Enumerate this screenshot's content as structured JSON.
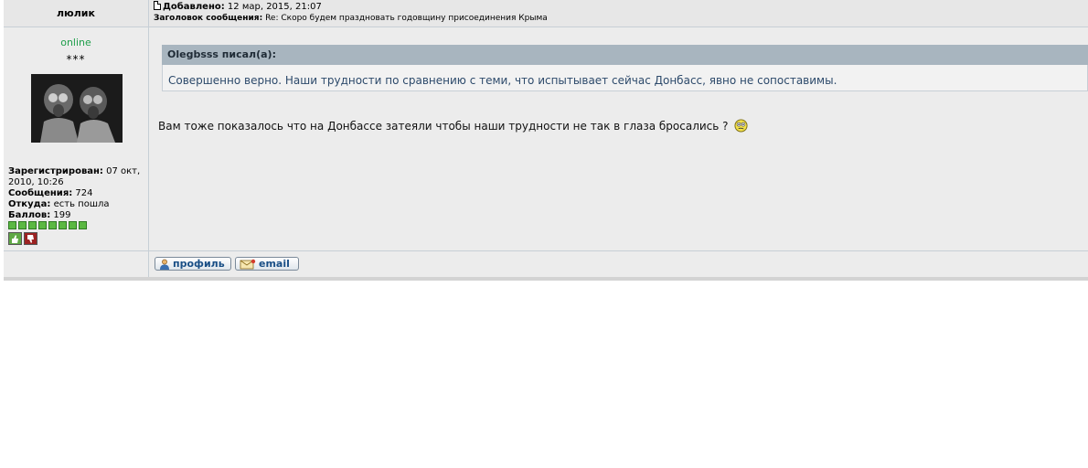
{
  "post": {
    "author": "люлик",
    "added_label": "Добавлено:",
    "added_value": " 12 мар, 2015, 21:07",
    "subject_label": "Заголовок сообщения:",
    "subject_value": " Re: Скоро будем праздновать годовщину присоединения Крыма"
  },
  "profile": {
    "status": "online",
    "rank": "***",
    "registered_label": "Зарегистрирован:",
    "registered_value": " 07 окт, 2010, 10:26",
    "messages_label": "Сообщения:",
    "messages_value": " 724",
    "from_label": "Откуда:",
    "from_value": " есть пошла",
    "points_label": "Баллов:",
    "points_value": " 199",
    "rating_level": 8,
    "colors": {
      "online": "#1e9e4a",
      "rating": "#5bb842"
    }
  },
  "quote": {
    "author_label": "Olegbsss писал(а):",
    "text": "Совершенно верно. Наши трудности по сравнению с теми, что испытывает сейчас Донбасс, явно не сопоставимы."
  },
  "message": {
    "text": "Вам тоже показалось что на Донбассе затеяли чтобы наши трудности не так в глаза бросались ?"
  },
  "buttons": {
    "profile_label": "профиль",
    "email_label": "email"
  },
  "icons": {
    "post": "page-icon",
    "smiley": "confused-smiley-icon",
    "vote_up": "thumbs-up-icon",
    "vote_down": "thumbs-down-icon",
    "profile": "user-icon",
    "email": "envelope-icon"
  }
}
